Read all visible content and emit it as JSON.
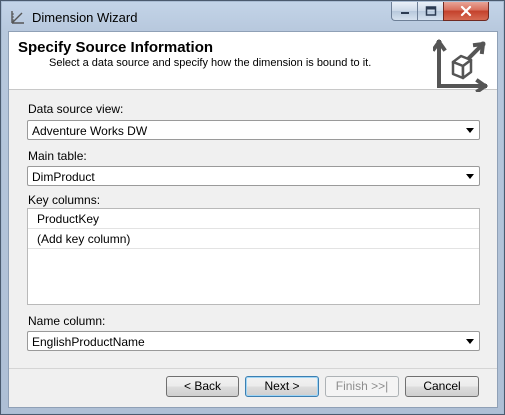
{
  "window": {
    "title": "Dimension Wizard"
  },
  "header": {
    "heading": "Specify Source Information",
    "subheading": "Select a data source and specify how the dimension is bound to it."
  },
  "fields": {
    "data_source_view": {
      "label": "Data source view:",
      "value": "Adventure Works DW"
    },
    "main_table": {
      "label": "Main table:",
      "value": "DimProduct"
    },
    "key_columns": {
      "label": "Key columns:",
      "items": [
        "ProductKey",
        "(Add key column)"
      ]
    },
    "name_column": {
      "label": "Name column:",
      "value": "EnglishProductName"
    }
  },
  "buttons": {
    "back": "< Back",
    "next": "Next >",
    "finish": "Finish >>|",
    "cancel": "Cancel"
  },
  "icons": {
    "app": "ruler-icon",
    "header": "dimension-cube-icon",
    "dropdown": "chevron-down-icon"
  },
  "colors": {
    "title_bar": "#b7c8dd",
    "close_button": "#c4412c",
    "default_button_border": "#3c7fb1"
  }
}
